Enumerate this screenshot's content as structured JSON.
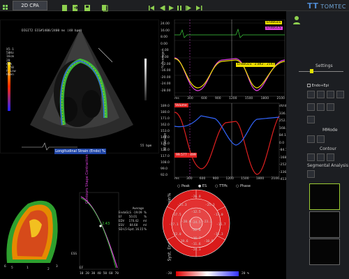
{
  "app": {
    "tab": "2D CPA",
    "brand": "TOMTEC"
  },
  "echo": {
    "header": "DIGIT2 ECG#1400/2400 ms (48 bpm)",
    "probe": [
      "X5-1",
      "50Hz",
      "16cm",
      "2D",
      "60%",
      "C 50",
      "P Low",
      "HGen"
    ],
    "scale_label": "55 bpm",
    "strain_label": "Longitudinal Strain (Endo) %"
  },
  "graph1": {
    "yticks": [
      "24.00",
      "16.00",
      "8.00",
      "0.00",
      "-4.00",
      "-8.00",
      "-12.00",
      "-16.00",
      "-20.00",
      "-24.00",
      "-28.00"
    ],
    "xticks": [
      "ms",
      "300",
      "600",
      "900",
      "1200",
      "1500",
      "1800",
      "2100"
    ],
    "ylabel": "% Average",
    "legend": [
      {
        "label": "EndoGLS",
        "color": "#f0e000"
      },
      {
        "label": "EndoGCS",
        "color": "#e040e0"
      }
    ],
    "tooltip": "EndoGLS: -2.842 : 2147"
  },
  "graph2": {
    "yticks_left": [
      "189.0",
      "180.0",
      "171.0",
      "162.0",
      "153.0",
      "144.0",
      "135.0",
      "126.0",
      "117.0",
      "108.0",
      "99.0",
      "92.0"
    ],
    "yticks_right": [
      "dV/dt",
      "336.4",
      "252.3",
      "168.2",
      "84.1",
      "0.0",
      "-84.1",
      "-168.2",
      "-252.3",
      "-336.4",
      "-413.0"
    ],
    "xticks": [
      "ms",
      "300",
      "600",
      "900",
      "1200",
      "1500",
      "1800",
      "2100"
    ],
    "ylabel": "ml Average",
    "volume_label": "Volume",
    "tooltip": "99.577 : 499"
  },
  "right_panel": {
    "settings": "Settings",
    "endo_epi": "Endo+Epi",
    "mmode": "MMode",
    "contour": "Contour",
    "segmental": "Segmental Analysis"
  },
  "bullseye": {
    "title": "Syst. Endo. Longitudinal Strain%",
    "options": [
      "Peak",
      "ES",
      "TTPk",
      "Phase"
    ],
    "outer": [
      "-26.0",
      "-24.3"
    ],
    "values": [
      "-25.3",
      "-25.3",
      "-17.5",
      "-17.0",
      "-12.5",
      "-27.1",
      "-20.6",
      "-24.5",
      "-23.3",
      "-15.7",
      "-22.8",
      "-22.0",
      "-15.3",
      "-19.6",
      "-10.9",
      "-16.7",
      "-11.6"
    ],
    "scale_min": "-20",
    "scale_max": "20 %"
  },
  "stats": {
    "title": "Average",
    "rows": [
      {
        "k": "EndoGLS",
        "v": "-19.09",
        "u": "%"
      },
      {
        "k": "EF",
        "v": "50.01",
        "u": "%"
      },
      {
        "k": "EDV",
        "v": "170.42",
        "u": "ml"
      },
      {
        "k": "ESV",
        "v": "84.68",
        "u": "ml"
      },
      {
        "k": "SD-L5-Syst.",
        "v": "16.15",
        "u": "%"
      }
    ]
  },
  "curve": {
    "label": "Contours Shape Contraction",
    "value": "2.43",
    "ef": "EF",
    "ess": "ESS",
    "xticks": [
      "10",
      "20",
      "30",
      "40",
      "50",
      "60",
      "70"
    ]
  },
  "model3d": {
    "segments": [
      "6",
      "5",
      "1",
      "2",
      "3"
    ]
  },
  "colors": {
    "yellow": "#f0e000",
    "magenta": "#e040e0",
    "green": "#3fcf3f",
    "red": "#e02020",
    "blue": "#2a6cff"
  }
}
